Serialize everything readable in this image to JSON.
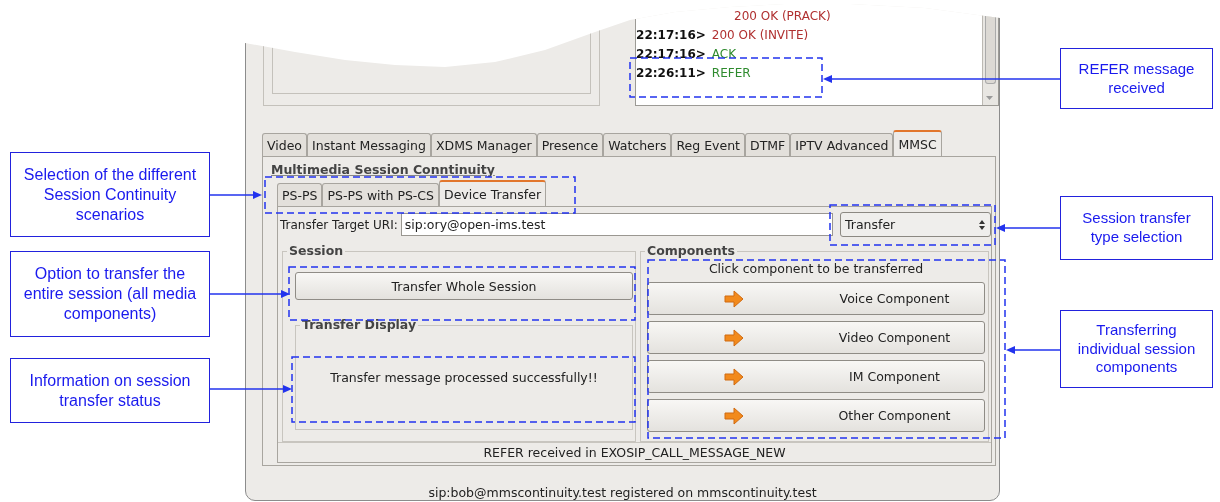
{
  "log": [
    {
      "message": "200 OK (PRACK)",
      "kind": "response"
    },
    {
      "time": "22:17:16>",
      "message": "200 OK (INVITE)",
      "kind": "response"
    },
    {
      "time": "22:17:16>",
      "message": "ACK",
      "kind": "request"
    },
    {
      "time": "22:26:11>",
      "message": "REFER",
      "kind": "request"
    }
  ],
  "tabs": [
    {
      "label": "Video",
      "selected": false
    },
    {
      "label": "Instant Messaging",
      "selected": false
    },
    {
      "label": "XDMS Manager",
      "selected": false
    },
    {
      "label": "Presence",
      "selected": false
    },
    {
      "label": "Watchers",
      "selected": false
    },
    {
      "label": "Reg Event",
      "selected": false
    },
    {
      "label": "DTMF",
      "selected": false
    },
    {
      "label": "IPTV Advanced",
      "selected": false
    },
    {
      "label": "MMSC",
      "selected": true
    }
  ],
  "section_title": "Multimedia Session Conntinuity",
  "mode_tabs": [
    {
      "label": "PS-PS",
      "selected": false
    },
    {
      "label": "PS-PS with PS-CS",
      "selected": false
    },
    {
      "label": "Device Transfer",
      "selected": true
    }
  ],
  "uri": {
    "label": "Transfer Target URI:",
    "value": "sip:ory@open-ims.test"
  },
  "transfer_type": "Transfer",
  "session": {
    "title": "Session",
    "button": "Transfer Whole Session",
    "display_title": "Transfer Display",
    "display_text": "Transfer message processed successfully!!"
  },
  "components": {
    "title": "Components",
    "hint": "Click component to be transferred",
    "buttons": [
      "Voice Component",
      "Video Component",
      "IM Component",
      "Other Component"
    ]
  },
  "status": "REFER received in EXOSIP_CALL_MESSAGE_NEW",
  "registration": "sip:bob@mmscontinuity.test registered on mmscontinuity.test",
  "callouts_left": [
    "Selection of the different Session Continuity scenarios",
    "Option to transfer the entire session (all media components)",
    "Information on session transfer status"
  ],
  "callouts_right": [
    "REFER message received",
    "Session transfer type selection",
    "Transferring individual session components"
  ]
}
